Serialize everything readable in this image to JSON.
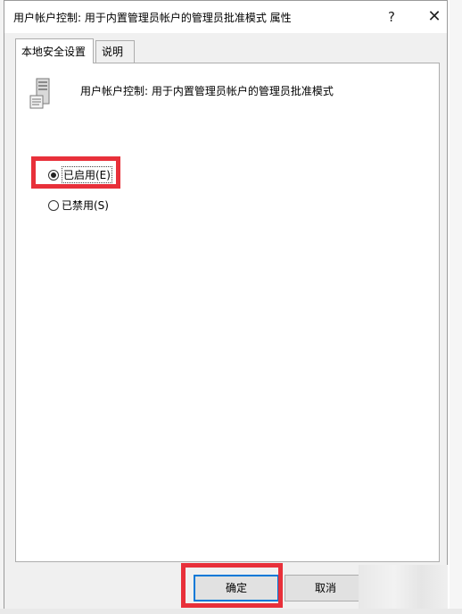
{
  "window": {
    "title": "用户帐户控制: 用于内置管理员帐户的管理员批准模式 属性",
    "help_glyph": "?",
    "close_glyph": "✕"
  },
  "tabs": [
    {
      "label": "本地安全设置",
      "active": true
    },
    {
      "label": "说明",
      "active": false
    }
  ],
  "policy": {
    "icon": "server-icon",
    "title": "用户帐户控制: 用于内置管理员帐户的管理员批准模式"
  },
  "options": [
    {
      "label": "已启用(E)",
      "checked": true
    },
    {
      "label": "已禁用(S)",
      "checked": false
    }
  ],
  "buttons": {
    "ok": "确定",
    "cancel": "取消"
  },
  "colors": {
    "highlight": "#e8303a",
    "focus": "#0078d7"
  }
}
